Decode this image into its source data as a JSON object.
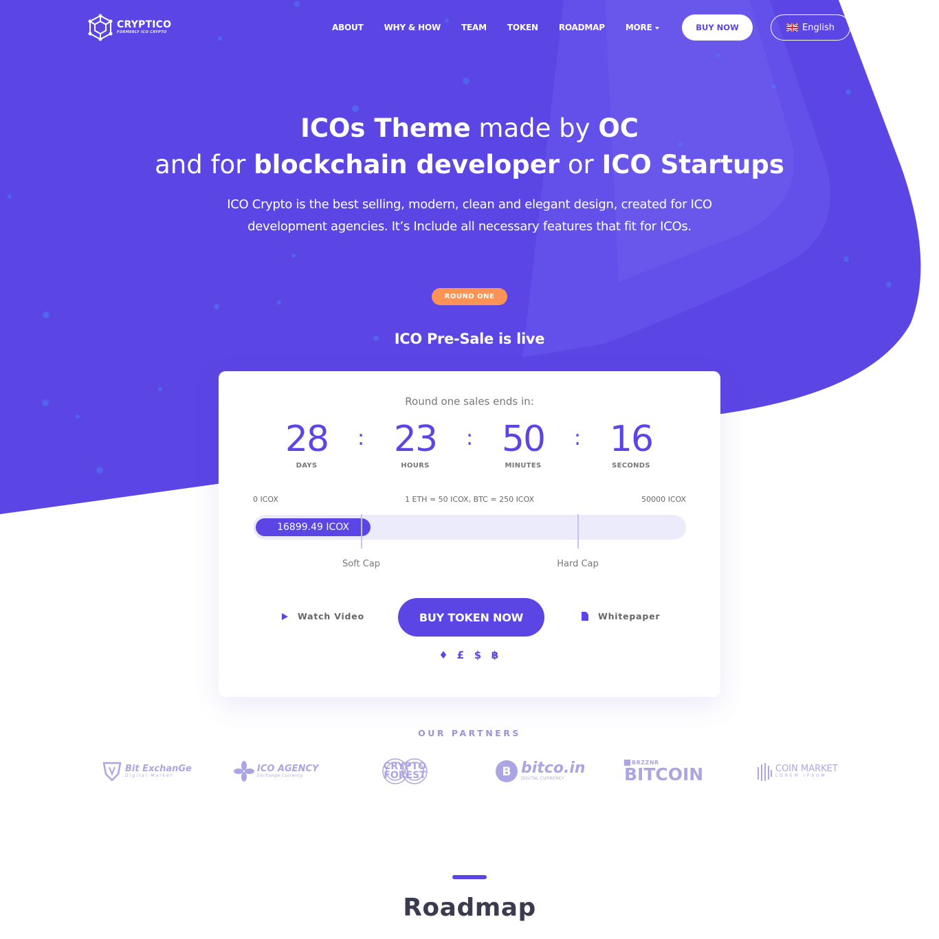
{
  "colors": {
    "brand": "#5b45e5",
    "brand_light": "#6f5df0",
    "badge_orange": "#fb9356",
    "track": "#ecebfc",
    "white": "#ffffff"
  },
  "header": {
    "logo": {
      "name": "CRYPTICO",
      "tagline": "FORMERLY ICO CRYPTO",
      "icon": "cube-network-icon"
    },
    "nav": [
      {
        "label": "ABOUT"
      },
      {
        "label": "WHY & HOW"
      },
      {
        "label": "TEAM"
      },
      {
        "label": "TOKEN"
      },
      {
        "label": "ROADMAP"
      },
      {
        "label": "MORE",
        "has_dropdown": true
      }
    ],
    "buy_now": "BUY NOW",
    "language": {
      "label": "English",
      "icon": "uk-flag-icon"
    }
  },
  "hero": {
    "line1": {
      "b1": "ICOs Theme",
      "t1": " made by ",
      "b2": "OC"
    },
    "line2": {
      "t1": "and for ",
      "b1": "blockchain developer",
      "t2": " or ",
      "b2": "ICO Startups"
    },
    "subtitle": "ICO Crypto is the best selling, modern, clean and elegant design, created for ICO development agencies. It’s Include all necessary features that fit for ICOs.",
    "badge": "ROUND ONE",
    "presale": "ICO Pre-Sale is live"
  },
  "sale_card": {
    "ends_label": "Round one sales ends in:",
    "countdown": [
      {
        "value": "28",
        "label": "DAYS"
      },
      {
        "value": "23",
        "label": "HOURS"
      },
      {
        "value": "50",
        "label": "MINUTES"
      },
      {
        "value": "16",
        "label": "SECONDS"
      }
    ],
    "separator": ":",
    "scale_min": "0 ICOX",
    "rate": "1 ETH = 50 ICOX, BTC = 250 ICOX",
    "scale_max": "50000 ICOX",
    "raised_label": "16899.49 ICOX",
    "raised_value": 16899.49,
    "max_value": 50000,
    "soft_cap": {
      "label": "Soft Cap",
      "fraction": 0.25
    },
    "hard_cap": {
      "label": "Hard Cap",
      "fraction": 0.75
    },
    "watch_video": "Watch Video",
    "buy_token": "BUY TOKEN NOW",
    "whitepaper": "Whitepaper",
    "currencies": [
      {
        "icon": "ethereum-icon",
        "glyph": "♦"
      },
      {
        "icon": "pound-icon",
        "glyph": "£"
      },
      {
        "icon": "dollar-icon",
        "glyph": "$"
      },
      {
        "icon": "bitcoin-icon",
        "glyph": "฿"
      }
    ]
  },
  "partners": {
    "title": "OUR PARTNERS",
    "logos": [
      {
        "name": "Bit ExchanGe",
        "sub": "Digital Market",
        "icon": "shield-logo-icon"
      },
      {
        "name": "ICO AGENCY",
        "sub": "Exchange Currency",
        "icon": "flower-logo-icon"
      },
      {
        "name": "CRYPTO FOREST",
        "sub": "",
        "icon": "rings-logo-icon"
      },
      {
        "name": "bitco.in",
        "sub": "DIGITAL CURRENCY",
        "icon": "bitcoin-coin-icon"
      },
      {
        "name": "BITCOIN",
        "sub": "BRZZNR",
        "icon": "b-box-icon"
      },
      {
        "name": "COIN MARKET",
        "sub": "LOREM IPSUM",
        "icon": "stripes-logo-icon"
      }
    ]
  },
  "roadmap": {
    "title": "Roadmap"
  }
}
